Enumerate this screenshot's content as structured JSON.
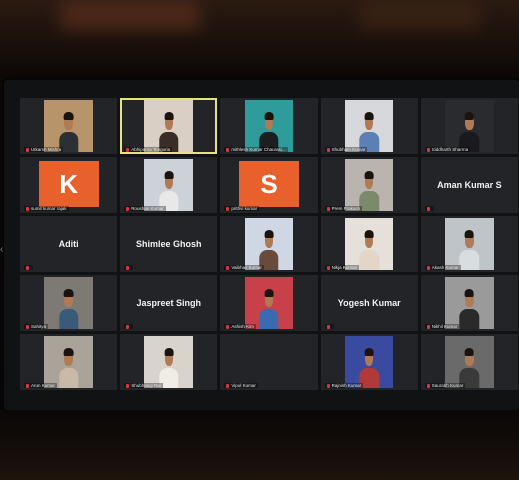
{
  "meeting": {
    "participants": [
      {
        "name": "Utkarsh Mishra",
        "type": "video",
        "bg": "#b8946a",
        "shirt": "#2c2f34"
      },
      {
        "name": "Abhiparna Tenguria",
        "type": "video",
        "bg": "#d9cfc4",
        "shirt": "#3a2c26",
        "active": true
      },
      {
        "name": "mithlesh Kumar Chaurasi...",
        "type": "video",
        "bg": "#2f9b9a",
        "shirt": "#1d1d22"
      },
      {
        "name": "Shubham Kumar",
        "type": "video",
        "bg": "#d6d8dc",
        "shirt": "#5c7fb4"
      },
      {
        "name": "Siddharth Sharma",
        "type": "video",
        "bg": "#2a2b2f",
        "shirt": "#1a1a1e"
      },
      {
        "name": "sumit kumar rajak",
        "type": "letter",
        "letter": "K"
      },
      {
        "name": "Roushan Kumar",
        "type": "video",
        "bg": "#cdd2d8",
        "shirt": "#e8e8e8"
      },
      {
        "name": "prithvi kumar",
        "type": "letter",
        "letter": "S"
      },
      {
        "name": "Prem Prakash",
        "type": "video",
        "bg": "#b9b4ad",
        "shirt": "#7a8a6a"
      },
      {
        "name": "Aman Kumar S",
        "type": "name"
      },
      {
        "name": "Aditi",
        "type": "name"
      },
      {
        "name": "Shimlee Ghosh",
        "type": "name"
      },
      {
        "name": "Vaibhav Kumar",
        "type": "video",
        "bg": "#cfd6e4",
        "shirt": "#6a4a3a"
      },
      {
        "name": "Nikja Kumari",
        "type": "video",
        "bg": "#e6e0da",
        "shirt": "#e4d6c6"
      },
      {
        "name": "Akash Kumar",
        "type": "video",
        "bg": "#bfc4c8",
        "shirt": "#d8dde0"
      },
      {
        "name": "Sahitya",
        "type": "video",
        "bg": "#7d7a74",
        "shirt": "#3a5a7a"
      },
      {
        "name": "Jaspreet Singh",
        "type": "name"
      },
      {
        "name": "Ashish Kim",
        "type": "video",
        "bg": "#c8404a",
        "shirt": "#3a6ab0"
      },
      {
        "name": "Yogesh Kumar",
        "type": "name"
      },
      {
        "name": "Nikhil Kumar",
        "type": "video",
        "bg": "#9a9a9a",
        "shirt": "#2a2a2a"
      },
      {
        "name": "Arun Kumar",
        "type": "video",
        "bg": "#a9a39a",
        "shirt": "#c9b9a9"
      },
      {
        "name": "Shubhangi Rai",
        "type": "video",
        "bg": "#d8d4cc",
        "shirt": "#f0ece6"
      },
      {
        "name": "Vipul Kumar",
        "type": "empty"
      },
      {
        "name": "Rajnish Kumar",
        "type": "video",
        "bg": "#3a4aa0",
        "shirt": "#b03a3a"
      },
      {
        "name": "Saurabh Kumar",
        "type": "video",
        "bg": "#6a6a6a",
        "shirt": "#3a3a3a"
      }
    ]
  }
}
